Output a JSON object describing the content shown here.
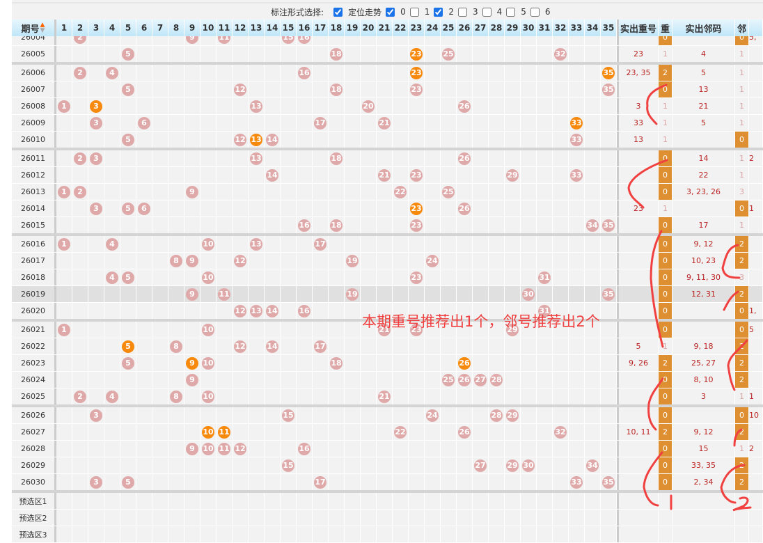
{
  "options": {
    "label": "标注形式选择:",
    "items": [
      {
        "label": "定位走势",
        "checked": true
      },
      {
        "label": "0",
        "checked": true
      },
      {
        "label": "1",
        "checked": false
      },
      {
        "label": "2",
        "checked": true
      },
      {
        "label": "3",
        "checked": false
      },
      {
        "label": "4",
        "checked": false
      },
      {
        "label": "5",
        "checked": false
      },
      {
        "label": "6",
        "checked": false
      }
    ]
  },
  "header": {
    "period": "期号",
    "sort_icon": "sort-arrows",
    "numbers": [
      "1",
      "2",
      "3",
      "4",
      "5",
      "6",
      "7",
      "8",
      "9",
      "10",
      "11",
      "12",
      "13",
      "14",
      "15",
      "16",
      "17",
      "18",
      "19",
      "20",
      "21",
      "22",
      "23",
      "24",
      "25",
      "26",
      "27",
      "28",
      "29",
      "30",
      "31",
      "32",
      "33",
      "34",
      "35"
    ],
    "repeat_nums": "实出重号",
    "repeat_count": "重",
    "neighbor_nums": "实出邻码",
    "neighbor_count": "邻"
  },
  "rows": [
    {
      "period": "26004",
      "balls": [
        2,
        9,
        11,
        15,
        16
      ],
      "hot": [],
      "rep": "",
      "rc": "0",
      "nb": "",
      "nc": "0",
      "ex": "5,"
    },
    {
      "period": "26005",
      "balls": [
        5,
        18,
        23,
        25,
        32
      ],
      "hot": [
        23
      ],
      "rep": "23",
      "rc": "1",
      "nb": "4",
      "nc": "1",
      "ex": ""
    },
    {
      "period": "26006",
      "balls": [
        2,
        4,
        16,
        23,
        35
      ],
      "hot": [
        23,
        35
      ],
      "rep": "23, 35",
      "rc": "2",
      "nb": "5",
      "nc": "1",
      "ex": ""
    },
    {
      "period": "26007",
      "balls": [
        5,
        12,
        18,
        23,
        35
      ],
      "hot": [],
      "rep": "",
      "rc": "0",
      "nb": "13",
      "nc": "1",
      "ex": ""
    },
    {
      "period": "26008",
      "balls": [
        1,
        3,
        13,
        20,
        26
      ],
      "hot": [
        3
      ],
      "rep": "3",
      "rc": "1",
      "nb": "21",
      "nc": "1",
      "ex": ""
    },
    {
      "period": "26009",
      "balls": [
        3,
        6,
        17,
        21,
        33
      ],
      "hot": [
        33
      ],
      "rep": "33",
      "rc": "1",
      "nb": "5",
      "nc": "1",
      "ex": ""
    },
    {
      "period": "26010",
      "balls": [
        5,
        12,
        13,
        14,
        33
      ],
      "hot": [
        13
      ],
      "rep": "13",
      "rc": "1",
      "nb": "",
      "nc": "0",
      "ex": ""
    },
    {
      "period": "26011",
      "balls": [
        2,
        3,
        13,
        18,
        26
      ],
      "hot": [],
      "rep": "",
      "rc": "0",
      "nb": "14",
      "nc": "1",
      "ex": "2"
    },
    {
      "period": "26012",
      "balls": [
        14,
        21,
        23,
        29,
        33
      ],
      "hot": [],
      "rep": "",
      "rc": "0",
      "nb": "22",
      "nc": "1",
      "ex": ""
    },
    {
      "period": "26013",
      "balls": [
        1,
        2,
        9,
        22,
        25
      ],
      "hot": [],
      "rep": "",
      "rc": "0",
      "nb": "3, 23, 26",
      "nc": "3",
      "ex": ""
    },
    {
      "period": "26014",
      "balls": [
        3,
        5,
        6,
        23,
        26
      ],
      "hot": [
        23
      ],
      "rep": "23",
      "rc": "1",
      "nb": "",
      "nc": "0",
      "ex": "1"
    },
    {
      "period": "26015",
      "balls": [
        16,
        18,
        23,
        34,
        35
      ],
      "hot": [],
      "rep": "",
      "rc": "0",
      "nb": "17",
      "nc": "1",
      "ex": ""
    },
    {
      "period": "26016",
      "balls": [
        1,
        4,
        10,
        13,
        17
      ],
      "hot": [],
      "rep": "",
      "rc": "0",
      "nb": "9, 12",
      "nc": "2",
      "ex": ""
    },
    {
      "period": "26017",
      "balls": [
        8,
        9,
        12,
        19,
        24
      ],
      "hot": [],
      "rep": "",
      "rc": "0",
      "nb": "10, 23",
      "nc": "2",
      "ex": ""
    },
    {
      "period": "26018",
      "balls": [
        4,
        5,
        10,
        23,
        31
      ],
      "hot": [],
      "rep": "",
      "rc": "0",
      "nb": "9, 11, 30",
      "nc": "3",
      "ex": ""
    },
    {
      "period": "26019",
      "balls": [
        9,
        11,
        19,
        30,
        35
      ],
      "hot": [],
      "rep": "",
      "rc": "0",
      "nb": "12, 31",
      "nc": "2",
      "ex": ""
    },
    {
      "period": "26020",
      "balls": [
        12,
        13,
        14,
        16,
        31
      ],
      "hot": [],
      "rep": "",
      "rc": "0",
      "nb": "",
      "nc": "0",
      "ex": "1,"
    },
    {
      "period": "26021",
      "balls": [
        1,
        10,
        21,
        23,
        29
      ],
      "hot": [],
      "rep": "",
      "rc": "0",
      "nb": "",
      "nc": "0",
      "ex": "5"
    },
    {
      "period": "26022",
      "balls": [
        5,
        8,
        12,
        14,
        17
      ],
      "hot": [
        5
      ],
      "rep": "5",
      "rc": "1",
      "nb": "9, 18",
      "nc": "2",
      "ex": ""
    },
    {
      "period": "26023",
      "balls": [
        5,
        9,
        10,
        18,
        26
      ],
      "hot": [
        9,
        26
      ],
      "rep": "9, 26",
      "rc": "2",
      "nb": "25, 27",
      "nc": "2",
      "ex": ""
    },
    {
      "period": "26024",
      "balls": [
        9,
        25,
        26,
        27,
        28
      ],
      "hot": [],
      "rep": "",
      "rc": "0",
      "nb": "8, 10",
      "nc": "2",
      "ex": ""
    },
    {
      "period": "26025",
      "balls": [
        2,
        4,
        8,
        10,
        21
      ],
      "hot": [],
      "rep": "",
      "rc": "0",
      "nb": "3",
      "nc": "1",
      "ex": "1"
    },
    {
      "period": "26026",
      "balls": [
        3,
        15,
        24,
        28,
        29
      ],
      "hot": [],
      "rep": "",
      "rc": "0",
      "nb": "",
      "nc": "0",
      "ex": "10"
    },
    {
      "period": "26027",
      "balls": [
        10,
        11,
        22,
        26,
        32
      ],
      "hot": [
        10,
        11
      ],
      "rep": "10, 11",
      "rc": "2",
      "nb": "9, 12",
      "nc": "2",
      "ex": ""
    },
    {
      "period": "26028",
      "balls": [
        9,
        10,
        11,
        12,
        16
      ],
      "hot": [],
      "rep": "",
      "rc": "0",
      "nb": "15",
      "nc": "1",
      "ex": "2"
    },
    {
      "period": "26029",
      "balls": [
        15,
        27,
        29,
        30,
        34
      ],
      "hot": [],
      "rep": "",
      "rc": "0",
      "nb": "33, 35",
      "nc": "2",
      "ex": ""
    },
    {
      "period": "26030",
      "balls": [
        3,
        5,
        17,
        33,
        35
      ],
      "hot": [],
      "rep": "",
      "rc": "0",
      "nb": "2, 34",
      "nc": "2",
      "ex": ""
    }
  ],
  "preselect": [
    "预选区1",
    "预选区2",
    "预选区3"
  ],
  "highlight_period": "26019",
  "annotation": {
    "note": "本期重号推荐出1个，邻号推荐出2个",
    "mark_repeat": "1",
    "mark_neighbor": "2"
  },
  "colors": {
    "hot_ball": "#f7890c",
    "ball": "#e0a9a9",
    "count_box": "#dd8f31",
    "ink": "#f04040"
  }
}
